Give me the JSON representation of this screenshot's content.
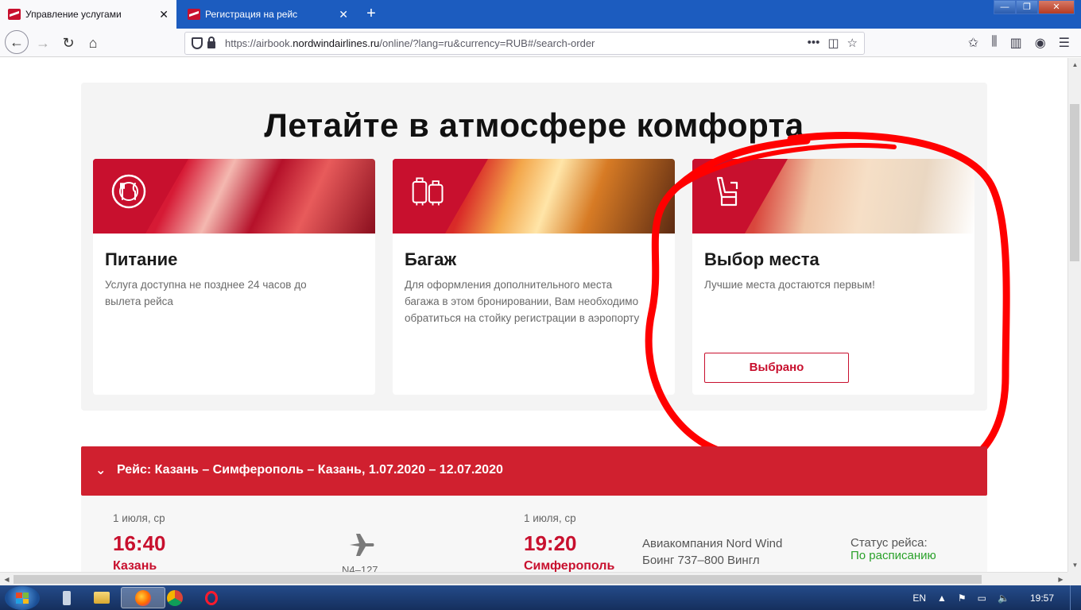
{
  "browser": {
    "tabs": [
      {
        "title": "Управление услугами",
        "active": true
      },
      {
        "title": "Регистрация на рейс",
        "active": false
      }
    ],
    "url": {
      "prefix": "https://airbook.",
      "host": "nordwindairlines.ru",
      "suffix": "/online/?lang=ru&currency=RUB#/search-order"
    },
    "window_buttons": {
      "minimize": "—",
      "maximize": "❐",
      "close": "✕"
    }
  },
  "services": {
    "title": "Летайте в атмосфере комфорта",
    "cards": [
      {
        "title": "Питание",
        "description": "Услуга доступна не позднее 24 часов до вылета рейса",
        "icon": "food-icon"
      },
      {
        "title": "Багаж",
        "description": "Для оформления дополнительного места багажа в этом бронировании, Вам необходимо обратиться на стойку регистрации в аэропорту",
        "icon": "luggage-icon"
      },
      {
        "title": "Выбор места",
        "description": "Лучшие места достаются первым!",
        "icon": "seat-icon",
        "button": "Выбрано"
      }
    ]
  },
  "flight": {
    "header": "Рейс: Казань – Симферополь – Казань, 1.07.2020 – 12.07.2020",
    "departure": {
      "date": "1 июля, ср",
      "time": "16:40",
      "city": "Казань"
    },
    "flight_number": "N4–127",
    "arrival": {
      "date": "1 июля, ср",
      "time": "19:20",
      "city": "Симферополь"
    },
    "airline": "Авиакомпания Nord Wind",
    "aircraft": "Боинг 737–800 Вингл",
    "status_label": "Статус рейса:",
    "status_value": "По расписанию"
  },
  "taskbar": {
    "language": "EN",
    "time": "19:57"
  },
  "colors": {
    "brand_red": "#c8102e",
    "status_green": "#2aa12a",
    "annotation_red": "#ff0000"
  }
}
